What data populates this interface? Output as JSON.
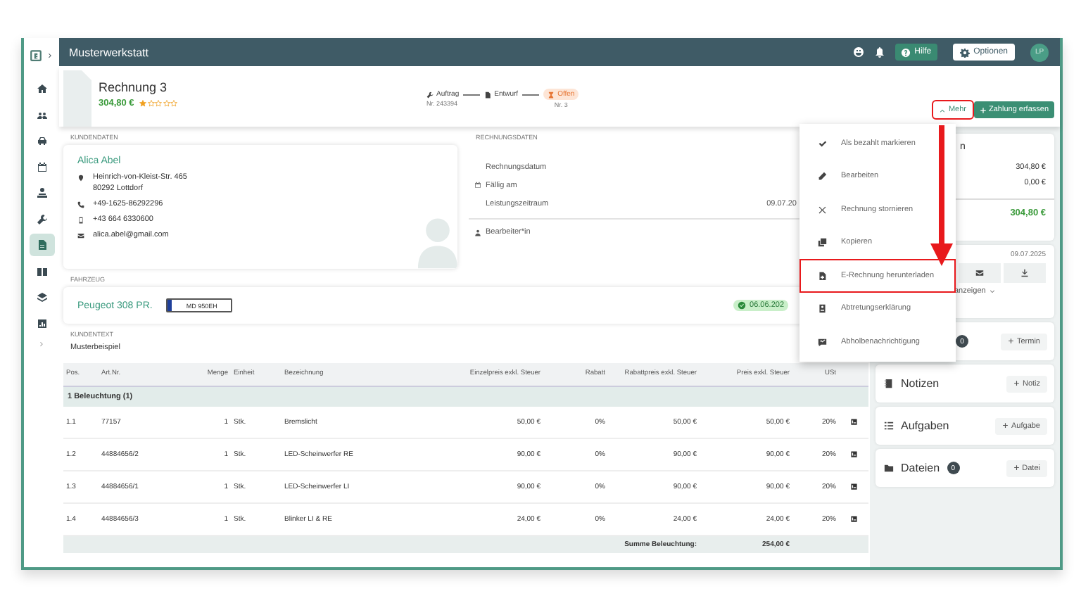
{
  "window": {
    "title": "Musterwerkstatt"
  },
  "sidebar": {
    "items": [
      {
        "kind": "home",
        "selected": false
      },
      {
        "kind": "users",
        "selected": false
      },
      {
        "kind": "car",
        "selected": false
      },
      {
        "kind": "calendar",
        "selected": false
      },
      {
        "kind": "service",
        "selected": false
      },
      {
        "kind": "wrench",
        "selected": false
      },
      {
        "kind": "document",
        "selected": true
      },
      {
        "kind": "book",
        "selected": false
      },
      {
        "kind": "layers",
        "selected": false
      },
      {
        "kind": "chart",
        "selected": false
      }
    ]
  },
  "topbar": {
    "help": "Hilfe",
    "options": "Optionen",
    "avatar": "LP"
  },
  "header": {
    "title": "Rechnung 3",
    "amount": "304,80 €",
    "stars": 1,
    "steps": [
      {
        "kind": "order",
        "label": "Auftrag",
        "number": "Nr. 243394",
        "active": false
      },
      {
        "kind": "draft",
        "label": "Entwurf",
        "active": false
      },
      {
        "kind": "open",
        "label": "Offen",
        "number": "Nr. 3",
        "active": true
      }
    ],
    "buttons": [
      {
        "kind": "more",
        "label": "Mehr",
        "highlighted": true
      },
      {
        "kind": "payment",
        "label": "Zahlung erfassen",
        "highlighted": false
      }
    ]
  },
  "customer": {
    "heading": "KUNDENDATEN",
    "name": "Alica Abel",
    "rows": [
      {
        "kind": "address",
        "lines": [
          "Heinrich-von-Kleist-Str. 465",
          "80292 Lottdorf"
        ]
      },
      {
        "kind": "phone",
        "lines": [
          "+49-1625-86292296"
        ]
      },
      {
        "kind": "mobile",
        "lines": [
          "+43 664 6330600"
        ]
      },
      {
        "kind": "email",
        "lines": [
          "alica.abel@gmail.com"
        ]
      }
    ]
  },
  "invoice_data": {
    "heading": "RECHNUNGSDATEN",
    "rows": [
      {
        "kind": "plain",
        "label": "Rechnungsdatum"
      },
      {
        "kind": "calendar",
        "label": "Fällig am"
      },
      {
        "kind": "plain",
        "label": "Leistungszeitraum",
        "value": "09.07.20"
      },
      {
        "kind": "person",
        "label": "Bearbeiter*in"
      }
    ]
  },
  "vehicle": {
    "heading": "FAHRZEUG",
    "name": "Peugeot 308 PR.",
    "plate": "MD 950EH",
    "date": "06.06.202"
  },
  "customer_text": {
    "heading": "KUNDENTEXT",
    "text": "Musterbeispiel"
  },
  "table": {
    "columns": [
      "Pos.",
      "Art.Nr.",
      "Menge",
      "Einheit",
      "Bezeichnung",
      "Einzelpreis exkl. Steuer",
      "Rabatt",
      "Rabattpreis exkl. Steuer",
      "Preis exkl. Steuer",
      "USt"
    ],
    "group": "1 Beleuchtung (1)",
    "rows": [
      [
        "1.1",
        "77157",
        "1",
        "Stk.",
        "Bremslicht",
        "50,00 €",
        "0%",
        "50,00 €",
        "50,00 €",
        "20%"
      ],
      [
        "1.2",
        "44884656/2",
        "1",
        "Stk.",
        "LED-Scheinwerfer RE",
        "90,00 €",
        "0%",
        "90,00 €",
        "90,00 €",
        "20%"
      ],
      [
        "1.3",
        "44884656/1",
        "1",
        "Stk.",
        "LED-Scheinwerfer LI",
        "90,00 €",
        "0%",
        "90,00 €",
        "90,00 €",
        "20%"
      ],
      [
        "1.4",
        "44884656/3",
        "1",
        "Stk.",
        "Blinker LI & RE",
        "24,00 €",
        "0%",
        "24,00 €",
        "24,00 €",
        "20%"
      ]
    ],
    "sum_label": "Summe Beleuchtung:",
    "sum_value": "254,00 €"
  },
  "summary": {
    "title": "n",
    "values": [
      "304,80 €",
      "0,00 €"
    ],
    "total": "304,80 €",
    "date": "09.07.2025",
    "show_more": "anzeigen"
  },
  "panels": [
    {
      "kind": "appointments",
      "count": "0",
      "button": "Termin"
    },
    {
      "kind": "notes",
      "title": "Notizen",
      "button": "Notiz"
    },
    {
      "kind": "tasks",
      "title": "Aufgaben",
      "button": "Aufgabe"
    },
    {
      "kind": "files",
      "title": "Dateien",
      "count": "0",
      "button": "Datei"
    }
  ],
  "menu": {
    "items": [
      {
        "kind": "check",
        "label": "Als bezahlt markieren",
        "highlighted": false
      },
      {
        "kind": "pencil",
        "label": "Bearbeiten",
        "highlighted": false
      },
      {
        "kind": "cross",
        "label": "Rechnung stornieren",
        "highlighted": false
      },
      {
        "kind": "copy",
        "label": "Kopieren",
        "highlighted": false
      },
      {
        "kind": "filedoc",
        "label": "E-Rechnung herunterladen",
        "highlighted": true
      },
      {
        "kind": "idcard",
        "label": "Abtretungserklärung",
        "highlighted": false
      },
      {
        "kind": "chat",
        "label": "Abholbenachrichtigung",
        "highlighted": false
      }
    ]
  }
}
